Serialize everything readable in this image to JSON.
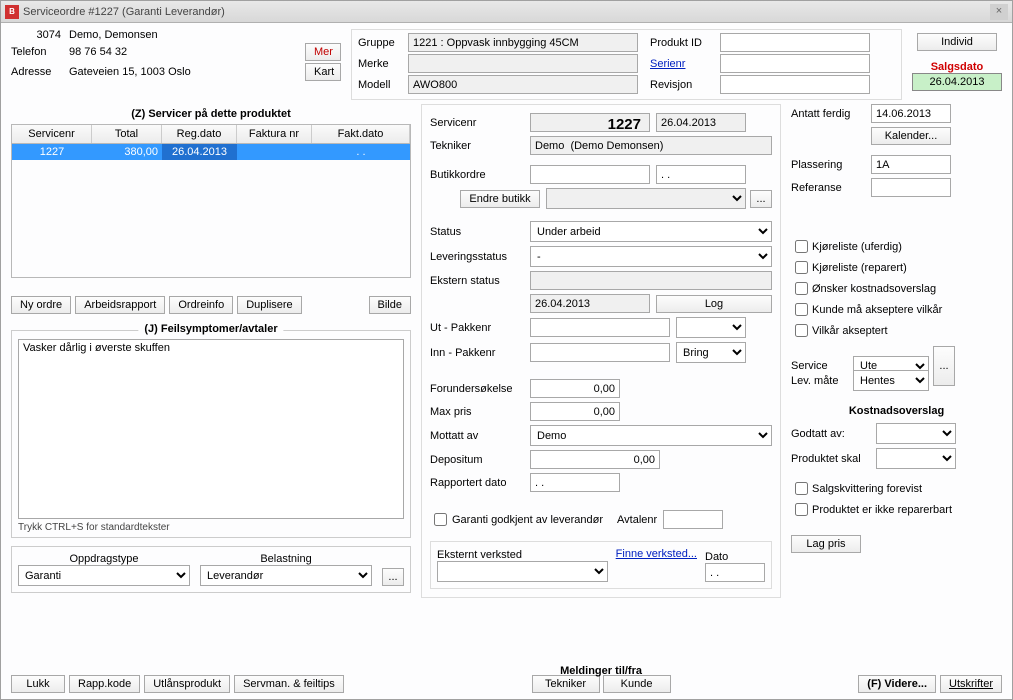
{
  "window": {
    "title": "Serviceordre #1227 (Garanti    Leverandør)"
  },
  "customer": {
    "id": "3074",
    "name": "Demo, Demonsen",
    "phone_label": "Telefon",
    "phone": "98 76 54 32",
    "address_label": "Adresse",
    "address": "Gateveien 15, 1003 Oslo",
    "mer_btn": "Mer",
    "kart_btn": "Kart"
  },
  "product": {
    "gruppe_label": "Gruppe",
    "gruppe": "1221 : Oppvask innbygging 45CM",
    "merke_label": "Merke",
    "merke": "",
    "modell_label": "Modell",
    "modell": "AWO800",
    "produkt_id_label": "Produkt ID",
    "produkt_id": "",
    "serienr_label": "Serienr",
    "serienr": "",
    "revisjon_label": "Revisjon",
    "revisjon": "",
    "individ_btn": "Individ",
    "salgsdato_label": "Salgsdato",
    "salgsdato": "26.04.2013"
  },
  "services_box": {
    "title": "(Z) Servicer på dette produktet",
    "headers": [
      "Servicenr",
      "Total",
      "Reg.dato",
      "Faktura nr",
      "Fakt.dato"
    ],
    "rows": [
      {
        "servicenr": "1227",
        "total": "380,00",
        "regdato": "26.04.2013",
        "fakturanr": "",
        "faktdato": ". ."
      }
    ]
  },
  "left_buttons": {
    "ny_ordre": "Ny ordre",
    "arbeidsrapport": "Arbeidsrapport",
    "ordreinfo": "Ordreinfo",
    "duplisere": "Duplisere",
    "bilde": "Bilde"
  },
  "feilsymptomer": {
    "title": "(J) Feilsymptomer/avtaler",
    "text": "Vasker dårlig i øverste skuffen",
    "note": "Trykk CTRL+S for standardtekster"
  },
  "oppdrag": {
    "type_label": "Oppdragstype",
    "type": "Garanti",
    "belastning_label": "Belastning",
    "belastning": "Leverandør"
  },
  "mid": {
    "servicenr_label": "Servicenr",
    "servicenr": "1227",
    "servicenr_dato": "26.04.2013",
    "tekniker_label": "Tekniker",
    "tekniker": "Demo  (Demo Demonsen)",
    "butikkordre_label": "Butikkordre",
    "butikkordre": "",
    "butikkordre_dato": ". .",
    "endre_butikk": "Endre butikk",
    "status_label": "Status",
    "status": "Under arbeid",
    "leveringsstatus_label": "Leveringsstatus",
    "leveringsstatus": "-",
    "ekstern_status_label": "Ekstern status",
    "ekstern_status_dato": "26.04.2013",
    "log_btn": "Log",
    "ut_pakke_label": "Ut - Pakkenr",
    "inn_pakke_label": "Inn - Pakkenr",
    "inn_pakke_carrier": "Bring",
    "forundersokelse_label": "Forundersøkelse",
    "forundersokelse": "0,00",
    "maxpris_label": "Max pris",
    "maxpris": "0,00",
    "mottatt_label": "Mottatt av",
    "mottatt": "Demo",
    "depositum_label": "Depositum",
    "depositum": "0,00",
    "rapportert_label": "Rapportert dato",
    "rapportert": ". .",
    "garanti_godkjent": "Garanti godkjent av leverandør",
    "avtalenr_label": "Avtalenr",
    "eksternt_label": "Eksternt verksted",
    "finne_verksted": "Finne verksted...",
    "dato_label": "Dato",
    "dato": ". ."
  },
  "right": {
    "antatt_label": "Antatt ferdig",
    "antatt": "14.06.2013",
    "kalender_btn": "Kalender...",
    "plassering_label": "Plassering",
    "plassering": "1A",
    "referanse_label": "Referanse",
    "checks": {
      "kjoreliste_uferdig": "Kjøreliste (uferdig)",
      "kjoreliste_reparert": "Kjøreliste (reparert)",
      "onsker_overslag": "Ønsker kostnadsoverslag",
      "kunde_akseptere": "Kunde må akseptere vilkår",
      "vilkar_akseptert": "Vilkår akseptert"
    },
    "service_label": "Service",
    "service": "Ute",
    "levmate_label": "Lev. måte",
    "levmate": "Hentes",
    "kostnad_title": "Kostnadsoverslag",
    "godtatt_label": "Godtatt av:",
    "produktet_skal_label": "Produktet skal",
    "salgskvittering": "Salgskvittering forevist",
    "ikke_reparerbart": "Produktet er ikke reparerbart",
    "lag_pris_btn": "Lag pris"
  },
  "footer": {
    "lukk": "Lukk",
    "rapp_kode": "Rapp.kode",
    "utlansprodukt": "Utlånsprodukt",
    "servman": "Servman. & feiltips",
    "meldinger": "Meldinger til/fra",
    "tekniker_btn": "Tekniker",
    "kunde_btn": "Kunde",
    "videre": "(F) Videre...",
    "utskrifter": "Utskrifter"
  }
}
